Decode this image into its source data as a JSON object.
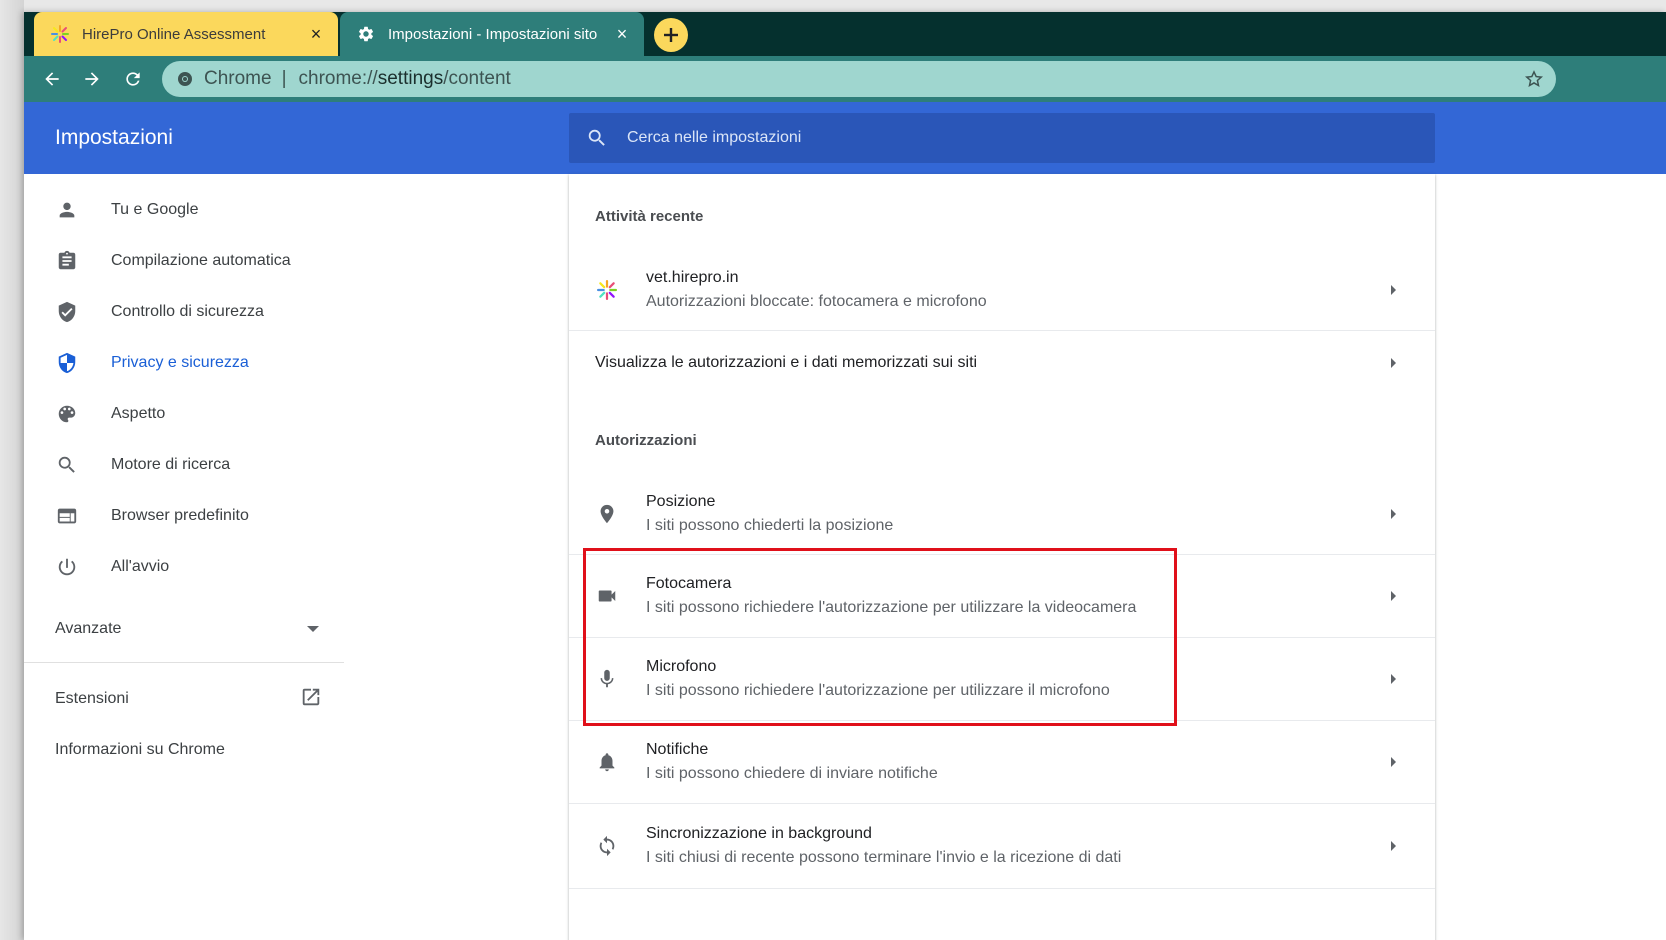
{
  "browser": {
    "tabs": [
      {
        "title": "HirePro Online Assessment",
        "icon": "hirepro-icon",
        "close": "×"
      },
      {
        "title": "Impostazioni - Impostazioni sito",
        "icon": "gear-icon",
        "close": "×"
      }
    ],
    "omnibox": {
      "chip": "Chrome",
      "separator": "|",
      "url_scheme": "chrome://",
      "url_host": "settings",
      "url_path": "/content"
    }
  },
  "header": {
    "title": "Impostazioni",
    "search_placeholder": "Cerca nelle impostazioni"
  },
  "sidebar": {
    "items": [
      {
        "label": "Tu e Google",
        "icon": "person-icon"
      },
      {
        "label": "Compilazione automatica",
        "icon": "clipboard-icon"
      },
      {
        "label": "Controllo di sicurezza",
        "icon": "shield-check-icon"
      },
      {
        "label": "Privacy e sicurezza",
        "icon": "shield-icon",
        "active": true
      },
      {
        "label": "Aspetto",
        "icon": "palette-icon"
      },
      {
        "label": "Motore di ricerca",
        "icon": "search-icon"
      },
      {
        "label": "Browser predefinito",
        "icon": "browser-icon"
      },
      {
        "label": "All'avvio",
        "icon": "power-icon"
      }
    ],
    "advanced_label": "Avanzate",
    "extensions_label": "Estensioni",
    "about_label": "Informazioni su Chrome"
  },
  "main": {
    "recent_title": "Attività recente",
    "recent_site": {
      "title": "vet.hirepro.in",
      "subtitle": "Autorizzazioni bloccate: fotocamera e microfono"
    },
    "view_permissions_label": "Visualizza le autorizzazioni e i dati memorizzati sui siti",
    "permissions_title": "Autorizzazioni",
    "permissions": [
      {
        "title": "Posizione",
        "subtitle": "I siti possono chiederti la posizione",
        "icon": "location-pin-icon"
      },
      {
        "title": "Fotocamera",
        "subtitle": "I siti possono richiedere l'autorizzazione per utilizzare la videocamera",
        "icon": "camera-icon"
      },
      {
        "title": "Microfono",
        "subtitle": "I siti possono richiedere l'autorizzazione per utilizzare il microfono",
        "icon": "microphone-icon"
      },
      {
        "title": "Notifiche",
        "subtitle": "I siti possono chiedere di inviare notifiche",
        "icon": "bell-icon"
      },
      {
        "title": "Sincronizzazione in background",
        "subtitle": "I siti chiusi di recente possono terminare l'invio e la ricezione di dati",
        "icon": "sync-icon"
      }
    ]
  },
  "colors": {
    "header_blue": "#3367d6",
    "active_blue": "#1a5fd6",
    "tab_active": "#fbd85c",
    "tab_inactive": "#2e7e7a",
    "highlight_red": "#e0101a"
  }
}
